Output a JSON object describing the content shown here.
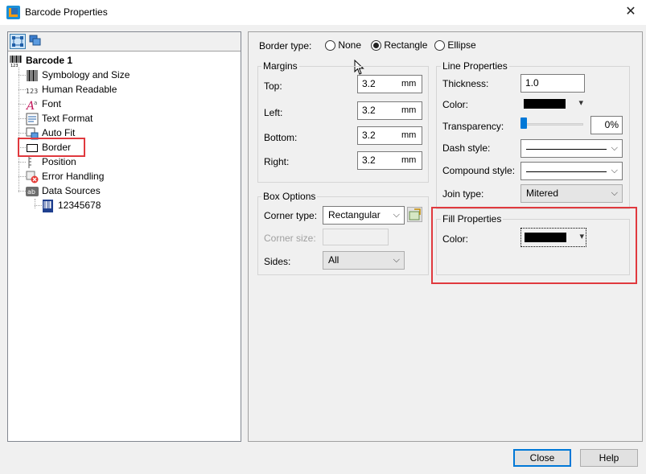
{
  "window": {
    "title": "Barcode Properties",
    "close_glyph": "✕"
  },
  "tree": {
    "root": "Barcode 1",
    "items": [
      {
        "label": "Symbology and Size",
        "icon": "barcode-icon"
      },
      {
        "label": "Human Readable",
        "icon": "numbers-icon"
      },
      {
        "label": "Font",
        "icon": "font-icon"
      },
      {
        "label": "Text Format",
        "icon": "text-format-icon"
      },
      {
        "label": "Auto Fit",
        "icon": "auto-fit-icon"
      },
      {
        "label": "Border",
        "icon": "border-icon"
      },
      {
        "label": "Position",
        "icon": "position-icon"
      },
      {
        "label": "Error Handling",
        "icon": "error-icon"
      },
      {
        "label": "Data Sources",
        "icon": "data-sources-icon"
      }
    ],
    "sub_item": "12345678"
  },
  "border_type": {
    "label": "Border type:",
    "options": [
      "None",
      "Rectangle",
      "Ellipse"
    ],
    "selected": "Rectangle"
  },
  "margins": {
    "title": "Margins",
    "top_label": "Top:",
    "top_value": "3.2",
    "left_label": "Left:",
    "left_value": "3.2",
    "bottom_label": "Bottom:",
    "bottom_value": "3.2",
    "right_label": "Right:",
    "right_value": "3.2",
    "unit": "mm"
  },
  "box_options": {
    "title": "Box Options",
    "corner_type_label": "Corner type:",
    "corner_type_value": "Rectangular",
    "corner_size_label": "Corner size:",
    "sides_label": "Sides:",
    "sides_value": "All"
  },
  "line_properties": {
    "title": "Line Properties",
    "thickness_label": "Thickness:",
    "thickness_value": "1.0",
    "color_label": "Color:",
    "color_value": "#000000",
    "transparency_label": "Transparency:",
    "transparency_value": "0%",
    "transparency_level": 0,
    "dash_style_label": "Dash style:",
    "compound_style_label": "Compound style:",
    "join_type_label": "Join type:",
    "join_type_value": "Mitered"
  },
  "fill_properties": {
    "title": "Fill Properties",
    "color_label": "Color:",
    "color_value": "#000000"
  },
  "buttons": {
    "close": "Close",
    "help": "Help"
  },
  "accents": {
    "highlight": "#e0393e",
    "selection": "#0078d7"
  }
}
